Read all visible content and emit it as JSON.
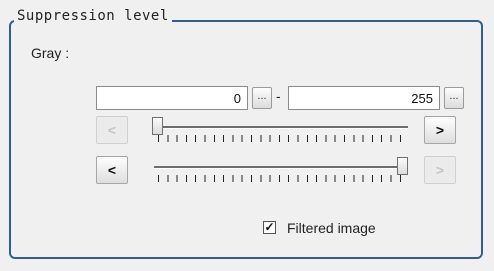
{
  "group": {
    "title": "Suppression level"
  },
  "gray": {
    "label": "Gray :",
    "min_value": "0",
    "max_value": "255",
    "range_separator": "-",
    "browse_label": "..."
  },
  "sliders": {
    "lower": {
      "value": 0,
      "min": 0,
      "max": 255,
      "left_label": "<",
      "right_label": ">",
      "left_enabled": false,
      "right_enabled": true
    },
    "upper": {
      "value": 255,
      "min": 0,
      "max": 255,
      "left_label": "<",
      "right_label": ">",
      "left_enabled": true,
      "right_enabled": false
    }
  },
  "filtered_image": {
    "label": "Filtered image",
    "checked": true,
    "check_mark": "✓"
  }
}
